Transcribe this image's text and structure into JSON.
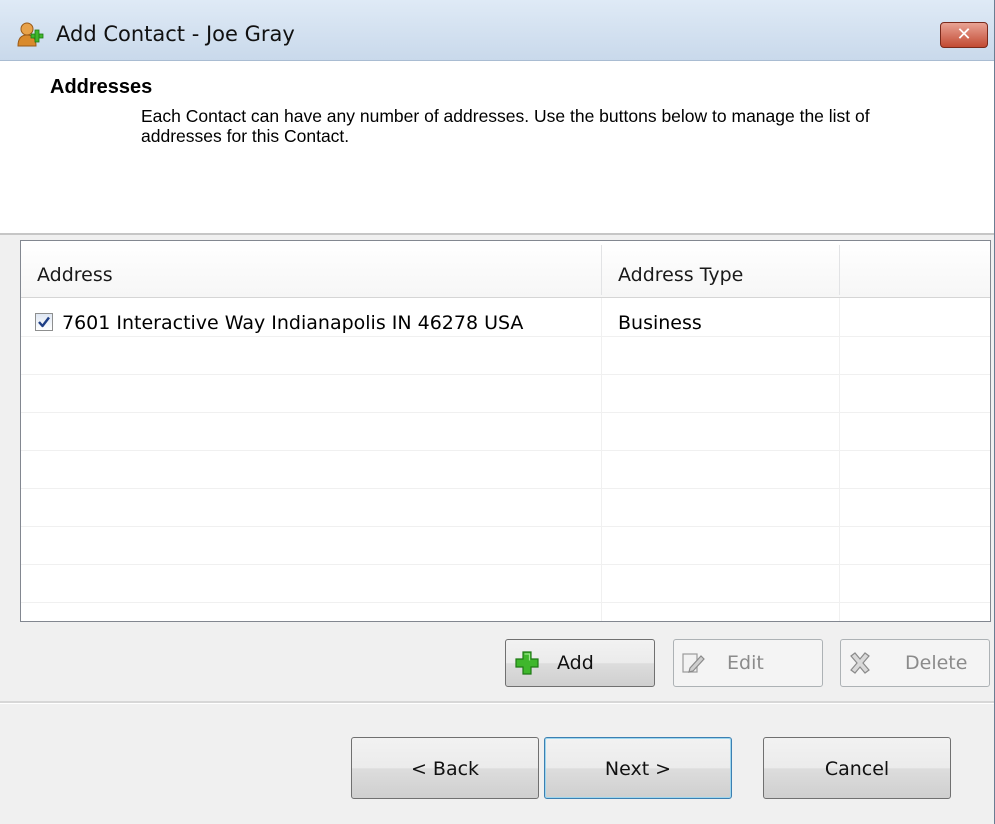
{
  "window": {
    "title": "Add Contact - Joe Gray",
    "close_label": "✕",
    "icon": "contact-add-icon"
  },
  "header": {
    "title": "Addresses",
    "description": "Each Contact can have any number of addresses.  Use the buttons below to manage the list of addresses for this Contact."
  },
  "list": {
    "columns": [
      "Address",
      "Address Type"
    ],
    "rows": [
      {
        "checked": true,
        "address": "7601 Interactive Way Indianapolis IN 46278 USA",
        "type": "Business"
      }
    ]
  },
  "actions": {
    "add": {
      "label": "Add",
      "icon": "plus-icon",
      "enabled": true
    },
    "edit": {
      "label": "Edit",
      "icon": "pencil-icon",
      "enabled": false
    },
    "delete": {
      "label": "Delete",
      "icon": "x-delete-icon",
      "enabled": false
    }
  },
  "navigation": {
    "back": "< Back",
    "next": "Next >",
    "cancel": "Cancel"
  },
  "colors": {
    "add_icon_green": "#3fb72c",
    "close_red": "#c24a33"
  }
}
